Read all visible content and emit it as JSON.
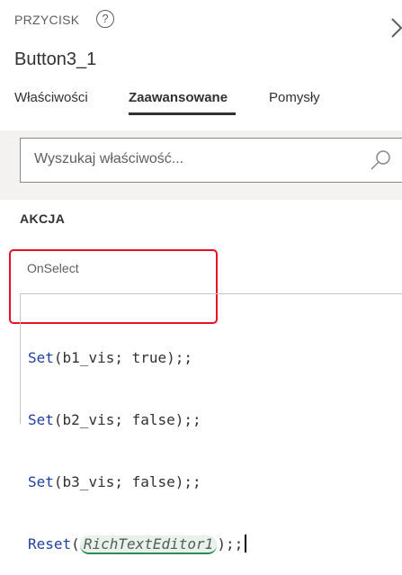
{
  "header": {
    "type_label": "PRZYCISK",
    "help_glyph": "?",
    "control_name": "Button3_1",
    "close_icon": "chevron-right-icon"
  },
  "tabs": [
    {
      "label": "Właściwości",
      "active": false
    },
    {
      "label": "Zaawansowane",
      "active": true
    },
    {
      "label": "Pomysły",
      "active": false
    }
  ],
  "search": {
    "placeholder": "Wyszukaj właściwość...",
    "icon": "search-icon"
  },
  "section": {
    "title": "AKCJA"
  },
  "property": {
    "name": "OnSelect",
    "highlight_color": "#e81123",
    "formula_lines": [
      {
        "fn": "Set",
        "args": "(b1_vis; true);;"
      },
      {
        "fn": "Set",
        "args": "(b2_vis; false);;"
      },
      {
        "fn": "Set",
        "args": "(b3_vis; false);;"
      },
      {
        "fn": "Reset",
        "open": "(",
        "control": "RichTextEditor1",
        "close": ");;"
      }
    ]
  },
  "colors": {
    "function_blue": "#1f3e9e",
    "control_pill_bg": "#e6f2ea",
    "panel_grey": "#f3f2f1"
  }
}
